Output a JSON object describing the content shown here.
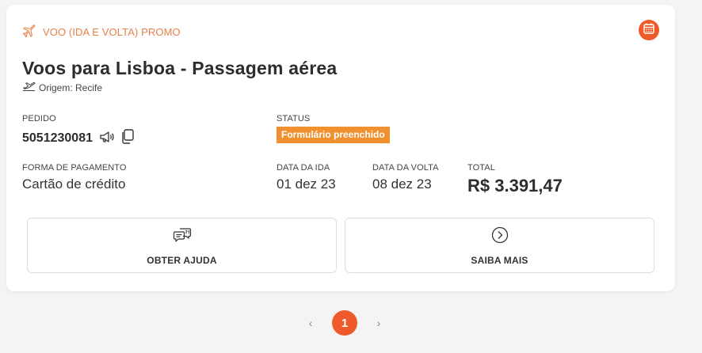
{
  "card": {
    "promo_label": "VOO (IDA E VOLTA) PROMO",
    "title": "Voos para Lisboa - Passagem aérea",
    "origin": "Origem: Recife",
    "order": {
      "label": "PEDIDO",
      "number": "5051230081"
    },
    "status": {
      "label": "STATUS",
      "value": "Formulário preenchido"
    },
    "payment": {
      "label": "FORMA DE PAGAMENTO",
      "value": "Cartão de crédito"
    },
    "departure": {
      "label": "DATA DA IDA",
      "value": "01 dez 23"
    },
    "return": {
      "label": "DATA DA VOLTA",
      "value": "08 dez 23"
    },
    "total": {
      "label": "TOTAL",
      "value": "R$ 3.391,47"
    },
    "actions": [
      {
        "label": "OBTER AJUDA",
        "icon": "help-chat-icon"
      },
      {
        "label": "SAIBA MAIS",
        "icon": "chevron-right-circle-icon"
      }
    ]
  },
  "pagination": {
    "prev": "‹",
    "current": "1",
    "next": "›"
  },
  "colors": {
    "accent": "#ef5a2a",
    "promo": "#e8804a",
    "status_badge": "#f0902f"
  }
}
